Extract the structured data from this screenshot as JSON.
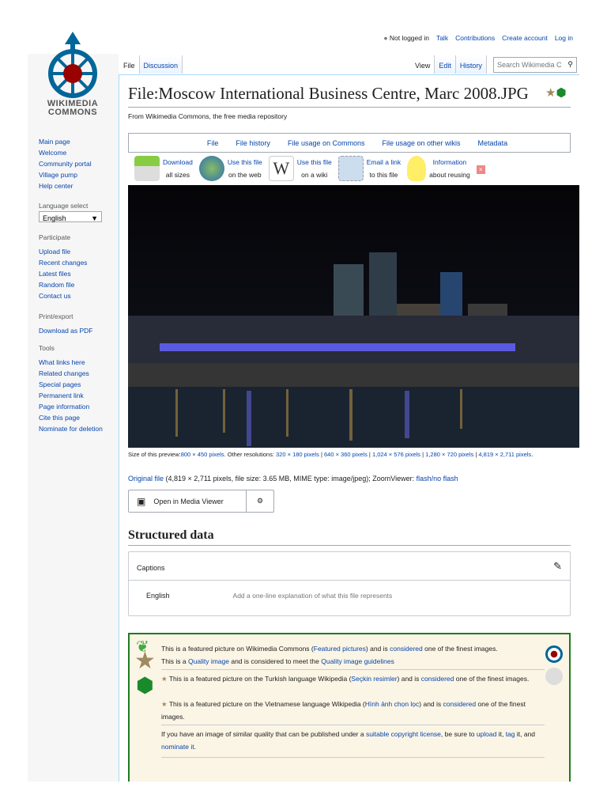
{
  "logo": {
    "line1": "WIKIMEDIA",
    "line2": "COMMONS"
  },
  "personal": {
    "not_logged_in": "Not logged in",
    "items": [
      "Talk",
      "Contributions",
      "Create account",
      "Log in"
    ]
  },
  "sidebar": {
    "main": [
      "Main page",
      "Welcome",
      "Community portal",
      "Village pump",
      "Help center"
    ],
    "language_heading": "Language select",
    "language_value": "English",
    "participate_heading": "Participate",
    "participate": [
      "Upload file",
      "Recent changes",
      "Latest files",
      "Random file",
      "Contact us"
    ],
    "print_heading": "Print/export",
    "print": [
      "Download as PDF"
    ],
    "tools_heading": "Tools",
    "tools": [
      "What links here",
      "Related changes",
      "Special pages",
      "Permanent link",
      "Page information",
      "Cite this page",
      "Nominate for deletion"
    ]
  },
  "tabs": {
    "left": [
      "File",
      "Discussion"
    ],
    "right": [
      "View",
      "Edit",
      "History"
    ]
  },
  "search": {
    "placeholder": "Search Wikimedia C"
  },
  "title": "File:Moscow International Business Centre, Marc 2008.JPG",
  "subtitle": "From Wikimedia Commons, the free media repository",
  "file_tabs": [
    "File",
    "File history",
    "File usage on Commons",
    "File usage on other wikis",
    "Metadata"
  ],
  "actions": [
    {
      "l1": "Download",
      "l2": "all sizes"
    },
    {
      "l1": "Use this file",
      "l2": "on the web"
    },
    {
      "l1": "Use this file",
      "l2": "on a wiki"
    },
    {
      "l1": "Email a link",
      "l2": "to this file"
    },
    {
      "l1": "Information",
      "l2": "about reusing"
    }
  ],
  "resolutions": {
    "label": "Size of this preview:",
    "preview": "800 × 450 pixels",
    "other_label": ". Other resolutions:",
    "items": [
      "320 × 180 pixels",
      "640 × 360 pixels",
      "1,024 × 576 pixels",
      "1,280 × 720 pixels",
      "4,819 × 2,711 pixels"
    ]
  },
  "original": {
    "link": "Original file",
    "info": " (4,819 × 2,711 pixels, file size: 3.65 MB, MIME type: image/jpeg); ZoomViewer: ",
    "zoom": "flash/no flash"
  },
  "media_viewer": "Open in Media Viewer",
  "structured_heading": "Structured data",
  "captions": {
    "label": "Captions",
    "lang": "English",
    "placeholder": "Add a one-line explanation of what this file represents"
  },
  "featured": {
    "l1a": "This is a featured picture on Wikimedia Commons (",
    "l1b": "Featured pictures",
    "l1c": ") and is ",
    "l1d": "considered",
    "l1e": " one of the finest images.",
    "l2a": "This is a ",
    "l2b": "Quality image",
    "l2c": " and is considered to meet the ",
    "l2d": "Quality image guidelines",
    "tr_a": "This is a featured picture on the Turkish language Wikipedia (",
    "tr_b": "Seçkin resimler",
    "tr_c": ") and is ",
    "tr_d": "considered",
    "tr_e": " one of the finest images.",
    "vi_a": "This is a featured picture on the Vietnamese language Wikipedia (",
    "vi_b": "Hình ảnh chọn lọc",
    "vi_c": ") and is ",
    "vi_d": "considered",
    "vi_e": " one of the finest images.",
    "up_a": "If you have an image of similar quality that can be published under a ",
    "up_b": "suitable copyright license",
    "up_c": ", be sure to ",
    "up_d": "upload",
    "up_e": " it, ",
    "up_f": "tag",
    "up_g": " it, and ",
    "up_h": "nominate it",
    "up_i": "."
  }
}
